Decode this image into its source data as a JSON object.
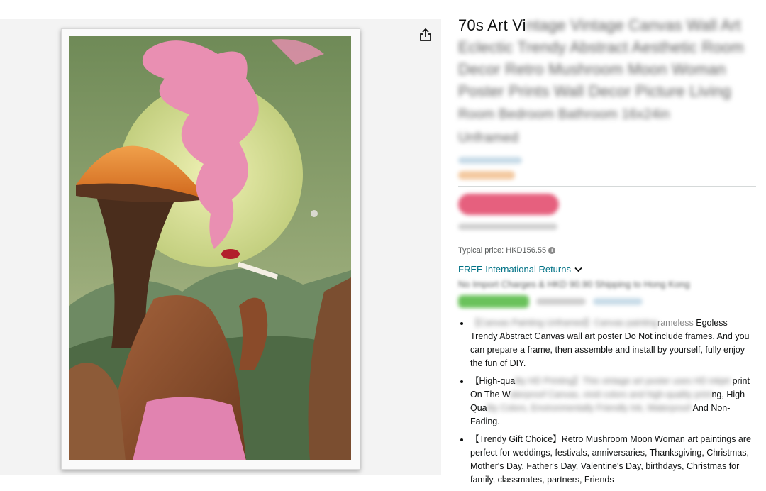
{
  "product": {
    "title_visible": "70s Art Vi",
    "title_blurred_lines": [
      "ntage Vintage Canvas Wall Art",
      "Eclectic Trendy Abstract Aesthetic Room",
      "Decor Retro Mushroom Moon Woman",
      "Poster Prints Wall Decor Picture Living",
      "Room Bedroom Bathroom 16x24in",
      "Unframed"
    ]
  },
  "pricing": {
    "typical_label": "Typical price:",
    "typical_price": "HKD156.55"
  },
  "returns": {
    "label": "FREE International Returns"
  },
  "shipping": {
    "text_visible": "No Import Charges & HKD 90.90 Shipping to Hong Kong"
  },
  "bullets": [
    {
      "blurred_prefix": "【Canvas Painting Unframed】Canvas painting",
      "tail_visible": "rameless",
      "text": "Egoless Trendy Abstract Canvas wall art poster Do Not include frames. And you can prepare a frame, then assemble and install by yourself, fully enjoy the fun of DIY."
    },
    {
      "prefix": "【High-qua",
      "blurred": "lity HD Printing】This vintage art poster uses HD inkjet",
      "suffix": "print",
      "line2_prefix": "On The W",
      "line2_blurred": "aterproof Canvas, vivid colors and high-quality print",
      "line2_suffix": "ng,",
      "line3_prefix": "High-Qua",
      "line3_blurred": "lity Colors, Environmentally Friendly Ink, Waterproof",
      "line3_suffix": "And",
      "line4": "Non-Fading."
    },
    {
      "text": "【Trendy Gift Choice】Retro Mushroom Moon Woman art paintings are perfect for weddings, festivals, anniversaries, Thanksgiving, Christmas, Mother's Day, Father's Day, Valentine's Day, birthdays, Christmas for family, classmates, partners, Friends"
    }
  ],
  "icons": {
    "share": "share-icon",
    "chevron": "chevron-down-icon",
    "info": "info-icon"
  },
  "colors": {
    "link": "#007185",
    "price_pink": "#e0395e",
    "badge_green": "#6ac25b"
  }
}
